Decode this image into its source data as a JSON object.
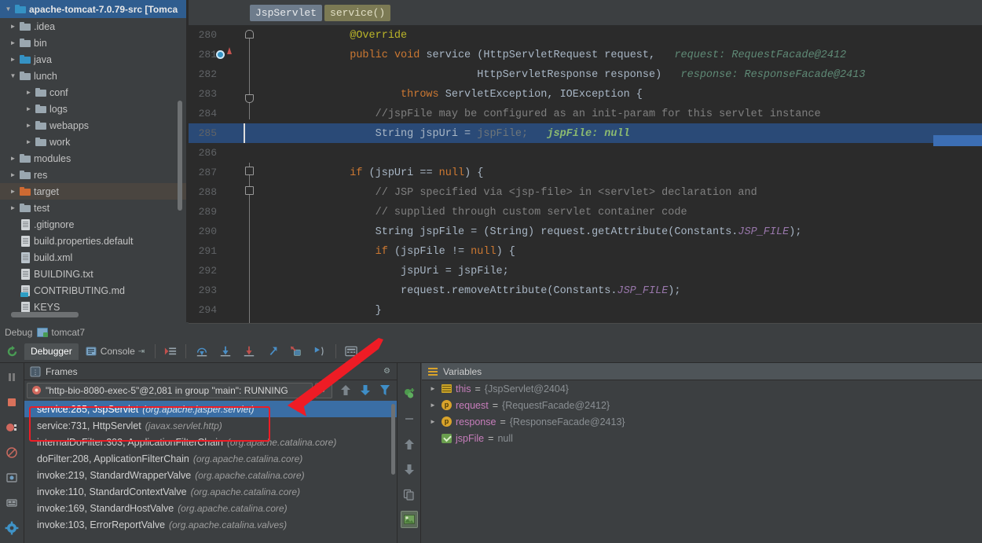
{
  "project": {
    "title": "apache-tomcat-7.0.79-src [Tomca",
    "items": [
      {
        "label": ".idea",
        "icon": "folder-icon",
        "indent": 1,
        "arrow": "collapsed",
        "kind": "folder",
        "color": "grey"
      },
      {
        "label": "bin",
        "icon": "folder-icon",
        "indent": 1,
        "arrow": "collapsed",
        "kind": "folder",
        "color": "grey"
      },
      {
        "label": "java",
        "icon": "folder-icon",
        "indent": 1,
        "arrow": "collapsed",
        "kind": "folder",
        "color": "blue"
      },
      {
        "label": "lunch",
        "icon": "folder-icon",
        "indent": 1,
        "arrow": "expanded",
        "kind": "folder",
        "color": "grey"
      },
      {
        "label": "conf",
        "icon": "folder-icon",
        "indent": 2,
        "arrow": "collapsed",
        "kind": "folder",
        "color": "grey"
      },
      {
        "label": "logs",
        "icon": "folder-icon",
        "indent": 2,
        "arrow": "collapsed",
        "kind": "folder",
        "color": "grey"
      },
      {
        "label": "webapps",
        "icon": "folder-icon",
        "indent": 2,
        "arrow": "collapsed",
        "kind": "folder",
        "color": "grey"
      },
      {
        "label": "work",
        "icon": "folder-icon",
        "indent": 2,
        "arrow": "collapsed",
        "kind": "folder",
        "color": "grey"
      },
      {
        "label": "modules",
        "icon": "folder-icon",
        "indent": 1,
        "arrow": "collapsed",
        "kind": "folder",
        "color": "grey"
      },
      {
        "label": "res",
        "icon": "folder-icon",
        "indent": 1,
        "arrow": "collapsed",
        "kind": "folder",
        "color": "grey"
      },
      {
        "label": "target",
        "icon": "folder-icon",
        "indent": 1,
        "arrow": "collapsed",
        "kind": "folder",
        "color": "orange",
        "selected": true
      },
      {
        "label": "test",
        "icon": "folder-icon",
        "indent": 1,
        "arrow": "collapsed",
        "kind": "folder",
        "color": "grey"
      },
      {
        "label": ".gitignore",
        "icon": "file-icon",
        "indent": 1,
        "arrow": "none",
        "kind": "file"
      },
      {
        "label": "build.properties.default",
        "icon": "file-icon",
        "indent": 1,
        "arrow": "none",
        "kind": "file"
      },
      {
        "label": "build.xml",
        "icon": "xml-file-icon",
        "indent": 1,
        "arrow": "none",
        "kind": "xml"
      },
      {
        "label": "BUILDING.txt",
        "icon": "file-icon",
        "indent": 1,
        "arrow": "none",
        "kind": "file"
      },
      {
        "label": "CONTRIBUTING.md",
        "icon": "markdown-file-icon",
        "indent": 1,
        "arrow": "none",
        "kind": "md"
      },
      {
        "label": "KEYS",
        "icon": "file-icon",
        "indent": 1,
        "arrow": "none",
        "kind": "file"
      }
    ]
  },
  "editor": {
    "breadcrumbs": [
      {
        "label": "JspServlet",
        "style": "class"
      },
      {
        "label": "service()",
        "style": "method"
      }
    ],
    "lines": [
      {
        "num": "280",
        "html": "            <a class=\"ann\">@Override</a>"
      },
      {
        "num": "281",
        "html": "            <a class=\"kw\">public</a> <a class=\"kw\">void</a> <a class=\"white\">service</a> (<a class=\"white\">HttpServletRequest request,</a>   <a class=\"hint\">request:</a> <a class=\"hint\">RequestFacade@2412</a>"
      },
      {
        "num": "282",
        "html": "                                <a class=\"white\">HttpServletResponse response)</a>   <a class=\"hint\">response:</a> <a class=\"hint\">ResponseFacade@2413</a>"
      },
      {
        "num": "283",
        "html": "                    <a class=\"kw\">throws</a> <a class=\"white\">ServletException, IOException {</a>"
      },
      {
        "num": "284",
        "html": "                <a class=\"cmt\">//jspFile may be configured as an init-param for this servlet instance</a>"
      },
      {
        "num": "285",
        "html": "                <a class=\"white\">String jspUri = </a><a class=\"grey\">jspFile;</a>   <a class=\"hintv\">jspFile: null</a>",
        "current": true
      },
      {
        "num": "286",
        "html": ""
      },
      {
        "num": "287",
        "html": "            <a class=\"kw\">if</a> <a class=\"white\">(jspUri == </a><a class=\"kw\">null</a><a class=\"white\">) {</a>"
      },
      {
        "num": "288",
        "html": "                <a class=\"cmt\">// JSP specified via &lt;jsp-file&gt; in &lt;servlet&gt; declaration and</a>"
      },
      {
        "num": "289",
        "html": "                <a class=\"cmt\">// supplied through custom servlet container code</a>"
      },
      {
        "num": "290",
        "html": "                <a class=\"white\">String jspFile = (String) request.getAttribute(Constants.</a><a class=\"fld\">JSP_FILE</a><a class=\"white\">);</a>"
      },
      {
        "num": "291",
        "html": "                <a class=\"kw\">if</a> <a class=\"white\">(jspFile != </a><a class=\"kw\">null</a><a class=\"white\">) {</a>"
      },
      {
        "num": "292",
        "html": "                    <a class=\"white\">jspUri = jspFile;</a>"
      },
      {
        "num": "293",
        "html": "                    <a class=\"white\">request.removeAttribute(Constants.</a><a class=\"fld\">JSP_FILE</a><a class=\"white\">);</a>"
      },
      {
        "num": "294",
        "html": "                <a class=\"white\">}</a>"
      }
    ]
  },
  "debug": {
    "window_label": "Debug",
    "config_name": "tomcat7",
    "tabs": [
      {
        "label": "Debugger",
        "icon": "debugger-icon",
        "active": true
      },
      {
        "label": "Console",
        "icon": "console-icon",
        "active": false
      }
    ],
    "toolbar_icons": [
      "mute-breakpoints-icon",
      "step-over-icon",
      "step-into-icon",
      "force-step-into-icon",
      "step-out-icon",
      "drop-frame-icon",
      "run-to-cursor-icon",
      "evaluate-expression-icon"
    ],
    "left_icons": [
      "resume-program-icon",
      "pause-program-icon",
      "stop-icon",
      "view-breakpoints-icon",
      "mute-breakpoints-icon",
      "restore-layout-icon",
      "settings-icon",
      "gear-icon"
    ],
    "frames": {
      "title": "Frames",
      "thread": "\"http-bio-8080-exec-5\"@2,081 in group \"main\": RUNNING",
      "thread_icon": "thread-icon",
      "rows": [
        {
          "method": "service:285, JspServlet",
          "package": "(org.apache.jasper.servlet)",
          "selected": true
        },
        {
          "method": "service:731, HttpServlet",
          "package": "(javax.servlet.http)",
          "selected": false
        },
        {
          "method": "internalDoFilter:303, ApplicationFilterChain",
          "package": "(org.apache.catalina.core)",
          "selected": false
        },
        {
          "method": "doFilter:208, ApplicationFilterChain",
          "package": "(org.apache.catalina.core)",
          "selected": false
        },
        {
          "method": "invoke:219, StandardWrapperValve",
          "package": "(org.apache.catalina.core)",
          "selected": false
        },
        {
          "method": "invoke:110, StandardContextValve",
          "package": "(org.apache.catalina.core)",
          "selected": false
        },
        {
          "method": "invoke:169, StandardHostValve",
          "package": "(org.apache.catalina.core)",
          "selected": false
        },
        {
          "method": "invoke:103, ErrorReportValve",
          "package": "(org.apache.catalina.valves)",
          "selected": false
        }
      ]
    },
    "variables": {
      "title": "Variables",
      "rows": [
        {
          "expand": "collapsed",
          "icon": "object-icon",
          "name": "this",
          "eq": "=",
          "value": "{JspServlet@2404}"
        },
        {
          "expand": "collapsed",
          "icon": "parameter-icon",
          "name": "request",
          "eq": "=",
          "value": "{RequestFacade@2412}"
        },
        {
          "expand": "collapsed",
          "icon": "parameter-icon",
          "name": "response",
          "eq": "=",
          "value": "{ResponseFacade@2413}"
        },
        {
          "expand": "none",
          "icon": "local-variable-icon",
          "name": "jspFile",
          "eq": "=",
          "value": "null"
        }
      ]
    },
    "mid_icons": [
      "add-watch-icon",
      "remove-watch-icon",
      "move-up-icon",
      "move-down-icon",
      "copy-icon",
      "inspect-icon"
    ]
  },
  "colors": {
    "accent_blue": "#3a6ea5",
    "selection_blue": "#2a4a77",
    "annotation_red": "#ee1c25",
    "panel_bg": "#3c3f41",
    "editor_bg": "#2b2b2b",
    "target_folder": "#cf6a32"
  }
}
